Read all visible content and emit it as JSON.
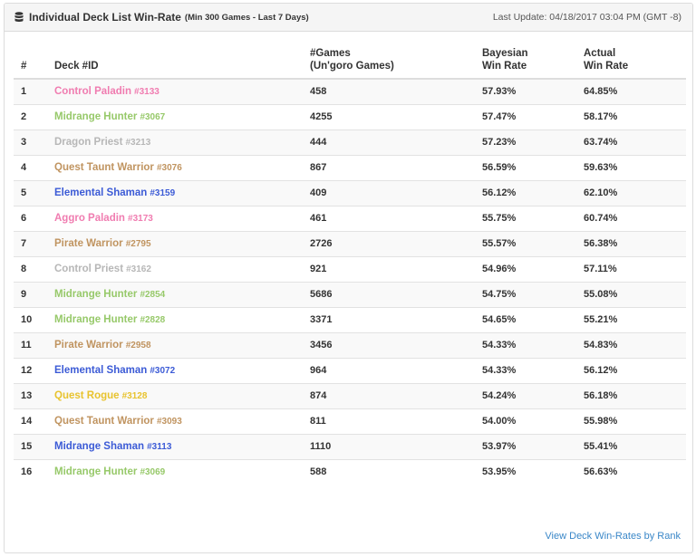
{
  "header": {
    "title": "Individual Deck List Win-Rate",
    "subtitle": "(Min 300 Games - Last 7 Days)",
    "last_update": "Last Update: 04/18/2017 03:04 PM (GMT -8)",
    "icon": "database-icon"
  },
  "table": {
    "columns": {
      "rank": "#",
      "deck": "Deck #ID",
      "games_line1": "#Games",
      "games_line2": "(Un'goro Games)",
      "bayes_line1": "Bayesian",
      "bayes_line2": "Win Rate",
      "actual_line1": "Actual",
      "actual_line2": "Win Rate"
    },
    "rows": [
      {
        "rank": "1",
        "deck": "Control Paladin",
        "id": "#3133",
        "color": "#f07cb0",
        "games": "458",
        "bayes": "57.93%",
        "actual": "64.85%"
      },
      {
        "rank": "2",
        "deck": "Midrange Hunter",
        "id": "#3067",
        "color": "#97c96a",
        "games": "4255",
        "bayes": "57.47%",
        "actual": "58.17%"
      },
      {
        "rank": "3",
        "deck": "Dragon Priest",
        "id": "#3213",
        "color": "#b7b7b7",
        "games": "444",
        "bayes": "57.23%",
        "actual": "63.74%"
      },
      {
        "rank": "4",
        "deck": "Quest Taunt Warrior",
        "id": "#3076",
        "color": "#c09460",
        "games": "867",
        "bayes": "56.59%",
        "actual": "59.63%"
      },
      {
        "rank": "5",
        "deck": "Elemental Shaman",
        "id": "#3159",
        "color": "#3c5bd6",
        "games": "409",
        "bayes": "56.12%",
        "actual": "62.10%"
      },
      {
        "rank": "6",
        "deck": "Aggro Paladin",
        "id": "#3173",
        "color": "#f07cb0",
        "games": "461",
        "bayes": "55.75%",
        "actual": "60.74%"
      },
      {
        "rank": "7",
        "deck": "Pirate Warrior",
        "id": "#2795",
        "color": "#c09460",
        "games": "2726",
        "bayes": "55.57%",
        "actual": "56.38%"
      },
      {
        "rank": "8",
        "deck": "Control Priest",
        "id": "#3162",
        "color": "#b7b7b7",
        "games": "921",
        "bayes": "54.96%",
        "actual": "57.11%"
      },
      {
        "rank": "9",
        "deck": "Midrange Hunter",
        "id": "#2854",
        "color": "#97c96a",
        "games": "5686",
        "bayes": "54.75%",
        "actual": "55.08%"
      },
      {
        "rank": "10",
        "deck": "Midrange Hunter",
        "id": "#2828",
        "color": "#97c96a",
        "games": "3371",
        "bayes": "54.65%",
        "actual": "55.21%"
      },
      {
        "rank": "11",
        "deck": "Pirate Warrior",
        "id": "#2958",
        "color": "#c09460",
        "games": "3456",
        "bayes": "54.33%",
        "actual": "54.83%"
      },
      {
        "rank": "12",
        "deck": "Elemental Shaman",
        "id": "#3072",
        "color": "#3c5bd6",
        "games": "964",
        "bayes": "54.33%",
        "actual": "56.12%"
      },
      {
        "rank": "13",
        "deck": "Quest Rogue",
        "id": "#3128",
        "color": "#e8c32e",
        "games": "874",
        "bayes": "54.24%",
        "actual": "56.18%"
      },
      {
        "rank": "14",
        "deck": "Quest Taunt Warrior",
        "id": "#3093",
        "color": "#c09460",
        "games": "811",
        "bayes": "54.00%",
        "actual": "55.98%"
      },
      {
        "rank": "15",
        "deck": "Midrange Shaman",
        "id": "#3113",
        "color": "#3c5bd6",
        "games": "1110",
        "bayes": "53.97%",
        "actual": "55.41%"
      },
      {
        "rank": "16",
        "deck": "Midrange Hunter",
        "id": "#3069",
        "color": "#97c96a",
        "games": "588",
        "bayes": "53.95%",
        "actual": "56.63%"
      }
    ]
  },
  "footer": {
    "link_label": "View Deck Win-Rates by Rank",
    "link_color": "#3a87c8"
  }
}
